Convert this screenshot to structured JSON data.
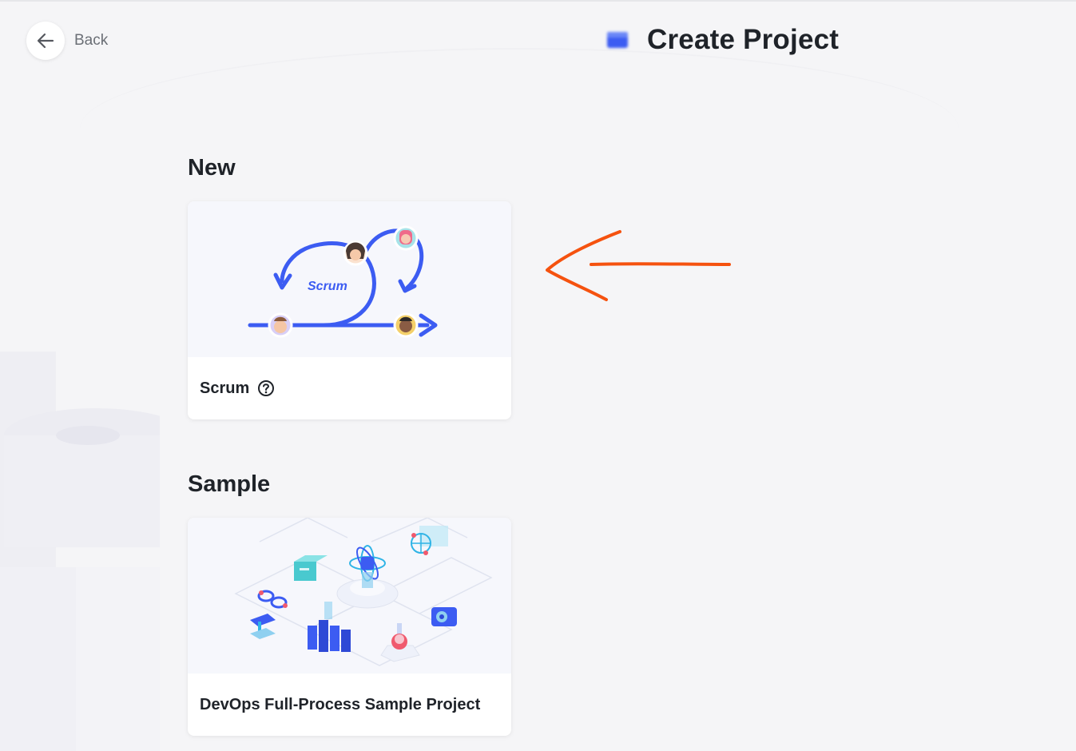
{
  "header": {
    "back_label": "Back",
    "title": "Create Project"
  },
  "sections": [
    {
      "heading": "New",
      "cards": [
        {
          "title": "Scrum",
          "illustration_label": "Scrum",
          "has_help_icon": true
        }
      ]
    },
    {
      "heading": "Sample",
      "cards": [
        {
          "title": "DevOps Full-Process Sample Project",
          "has_help_icon": false
        }
      ]
    }
  ],
  "colors": {
    "accent_blue": "#3c5cf2",
    "annotation_orange": "#f5520f",
    "background": "#f5f5f7",
    "card_bg": "#ffffff",
    "text_primary": "#1f2329",
    "text_secondary": "#6b6f76"
  },
  "icons": {
    "back": "arrow-left-icon",
    "help": "question-circle-icon",
    "logo": "project-logo-icon"
  }
}
